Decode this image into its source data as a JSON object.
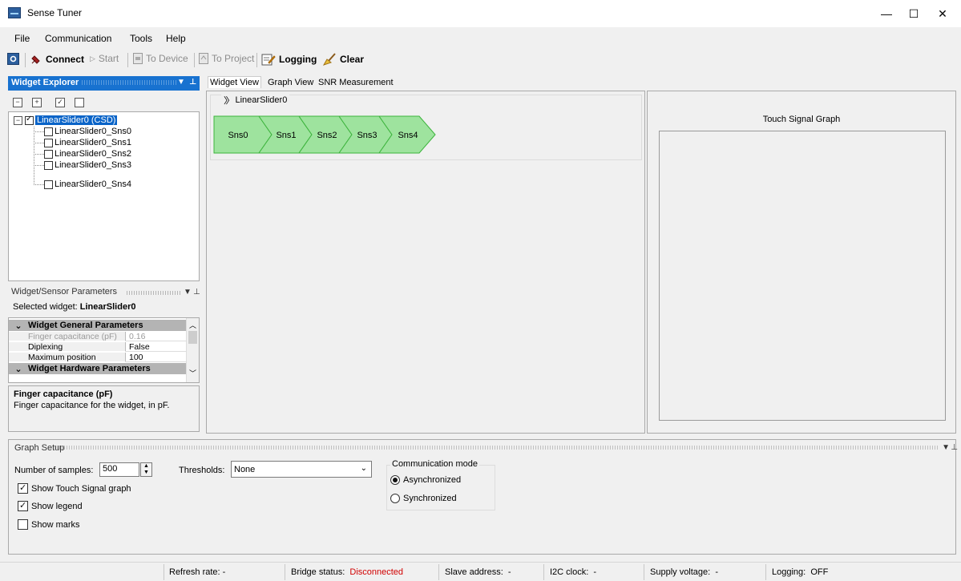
{
  "window": {
    "title": "Sense Tuner",
    "minimize": "—",
    "maximize": "☐",
    "close": "✕"
  },
  "menu": [
    "File",
    "Communication",
    "Tools",
    "Help"
  ],
  "toolbar": {
    "connect": "Connect",
    "start": "Start",
    "to_device": "To Device",
    "to_project": "To Project",
    "logging": "Logging",
    "clear": "Clear"
  },
  "widget_explorer": {
    "title": "Widget Explorer",
    "tree": {
      "root": "LinearSlider0 (CSD)",
      "children": [
        "LinearSlider0_Sns0",
        "LinearSlider0_Sns1",
        "LinearSlider0_Sns2",
        "LinearSlider0_Sns3",
        "LinearSlider0_Sns4"
      ]
    }
  },
  "params": {
    "title": "Widget/Sensor Parameters",
    "selected_label": "Selected widget:",
    "selected_value": "LinearSlider0",
    "cat1": "Widget General Parameters",
    "rows": [
      {
        "name": "Finger capacitance (pF)",
        "value": "0.16"
      },
      {
        "name": "Diplexing",
        "value": "False"
      },
      {
        "name": "Maximum position",
        "value": "100"
      }
    ],
    "cat2": "Widget Hardware Parameters",
    "desc_title": "Finger capacitance (pF)",
    "desc_text": "Finger capacitance for the widget, in pF."
  },
  "tabs": [
    "Widget View",
    "Graph View",
    "SNR Measurement"
  ],
  "widget_view": {
    "slider_title": "LinearSlider0",
    "segments": [
      "Sns0",
      "Sns1",
      "Sns2",
      "Sns3",
      "Sns4"
    ]
  },
  "graph": {
    "title": "Touch Signal Graph"
  },
  "graph_setup": {
    "title": "Graph Setup",
    "samples_label": "Number of samples:",
    "samples_value": "500",
    "thresholds_label": "Thresholds:",
    "thresholds_value": "None",
    "show_touch": "Show Touch Signal graph",
    "show_legend": "Show legend",
    "show_marks": "Show marks",
    "comm_title": "Communication mode",
    "async": "Asynchronized",
    "sync": "Synchronized"
  },
  "status": {
    "refresh_label": "Refresh rate:",
    "refresh_value": "-",
    "bridge_label": "Bridge status:",
    "bridge_value": "Disconnected",
    "slave_label": "Slave address:",
    "slave_value": "-",
    "i2c_label": "I2C clock:",
    "i2c_value": "-",
    "supply_label": "Supply voltage:",
    "supply_value": "-",
    "logging_label": "Logging:",
    "logging_value": "OFF"
  },
  "colors": {
    "accent": "#1872d0",
    "segment_fill": "#9ee39e",
    "segment_border": "#3cb43c",
    "error": "#d10000"
  }
}
